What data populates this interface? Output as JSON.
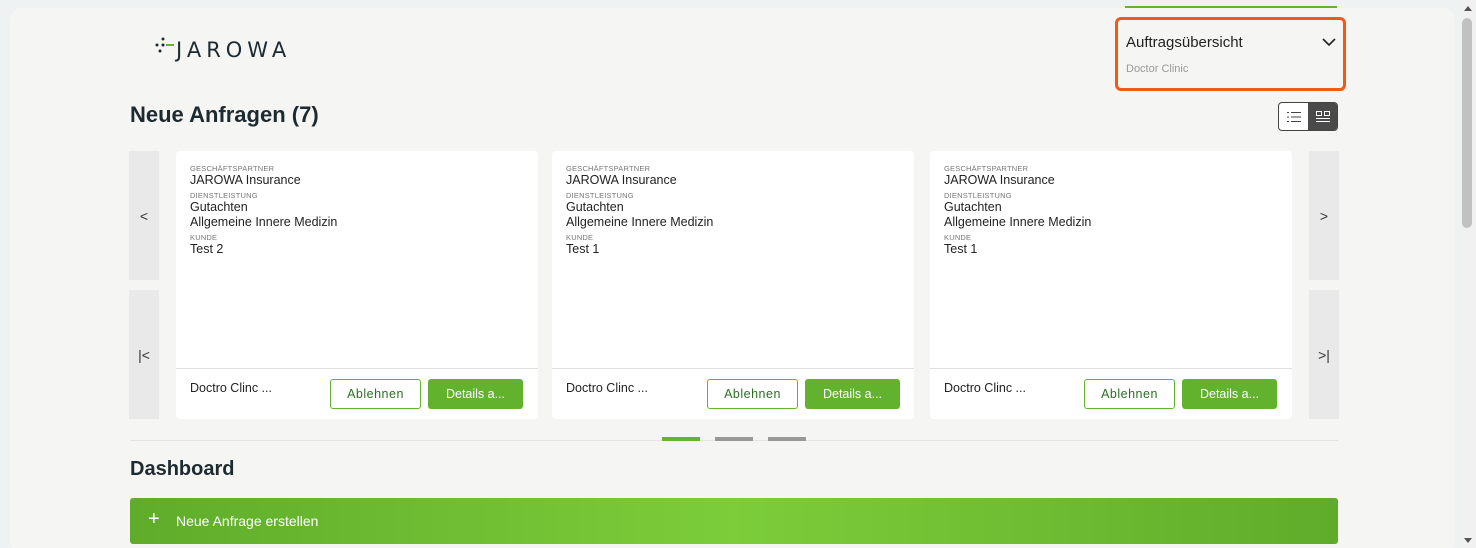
{
  "header": {
    "logo_text": "JAROWA",
    "selector": {
      "title": "Auftragsübersicht",
      "subtitle": "Doctor Clinic"
    }
  },
  "requests": {
    "title": "Neue Anfragen (7)",
    "nav": {
      "prev": "<",
      "first": "|<",
      "next": ">",
      "last": ">|"
    },
    "cards": [
      {
        "partner_label": "GESCHÄFTSPARTNER",
        "partner": "JAROWA Insurance",
        "service_label": "DIENSTLEISTUNG",
        "service_line1": "Gutachten",
        "service_line2": "Allgemeine Innere Medizin",
        "customer_label": "KUNDE",
        "customer": "Test 2",
        "owner": "Doctro Clinc ...",
        "reject": "Ablehnen",
        "details": "Details a..."
      },
      {
        "partner_label": "GESCHÄFTSPARTNER",
        "partner": "JAROWA Insurance",
        "service_label": "DIENSTLEISTUNG",
        "service_line1": "Gutachten",
        "service_line2": "Allgemeine Innere Medizin",
        "customer_label": "KUNDE",
        "customer": "Test 1",
        "owner": "Doctro Clinc ...",
        "reject": "Ablehnen",
        "details": "Details a..."
      },
      {
        "partner_label": "GESCHÄFTSPARTNER",
        "partner": "JAROWA Insurance",
        "service_label": "DIENSTLEISTUNG",
        "service_line1": "Gutachten",
        "service_line2": "Allgemeine Innere Medizin",
        "customer_label": "KUNDE",
        "customer": "Test 1",
        "owner": "Doctro Clinc ...",
        "reject": "Ablehnen",
        "details": "Details a..."
      }
    ],
    "pagination": {
      "pages": 3,
      "active_page": 1
    }
  },
  "dashboard": {
    "title": "Dashboard",
    "create_plus": "+",
    "create_label": "Neue Anfrage erstellen"
  },
  "colors": {
    "accent": "#65b32e",
    "highlight": "#f05a12",
    "text": "#1d2a30"
  },
  "icons": {
    "list_view": "list-icon",
    "grid_view": "grid-icon",
    "selector": "chevron-down-icon"
  }
}
